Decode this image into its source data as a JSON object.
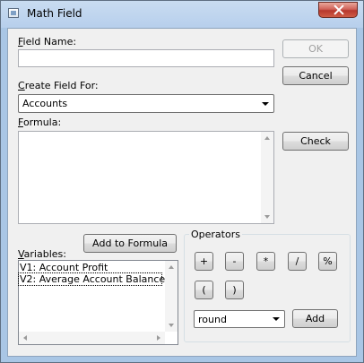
{
  "window": {
    "title": "Math Field",
    "close_icon": "close-icon"
  },
  "form": {
    "field_name_prefix": "F",
    "field_name_rest": "ield Name:",
    "field_name_value": "",
    "create_field_prefix": "C",
    "create_field_rest": "reate Field For:",
    "create_field_value": "Accounts",
    "formula_prefix": "F",
    "formula_rest": "ormula:",
    "formula_value": "",
    "variables_prefix": "V",
    "variables_rest": "ariables:"
  },
  "buttons": {
    "ok": "OK",
    "cancel": "Cancel",
    "check_prefix": "C",
    "check_rest": "heck",
    "add_to_formula_prefix": "A",
    "add_to_formula_rest": "dd to Formula",
    "add": "Add"
  },
  "variables": [
    "V1: Account Profit",
    "V2: Average Account Balance"
  ],
  "operators": {
    "title": "Operators",
    "row1": [
      "+",
      "-",
      "*",
      "/",
      "%"
    ],
    "row2": [
      "(",
      ")"
    ],
    "function_value": "round"
  }
}
